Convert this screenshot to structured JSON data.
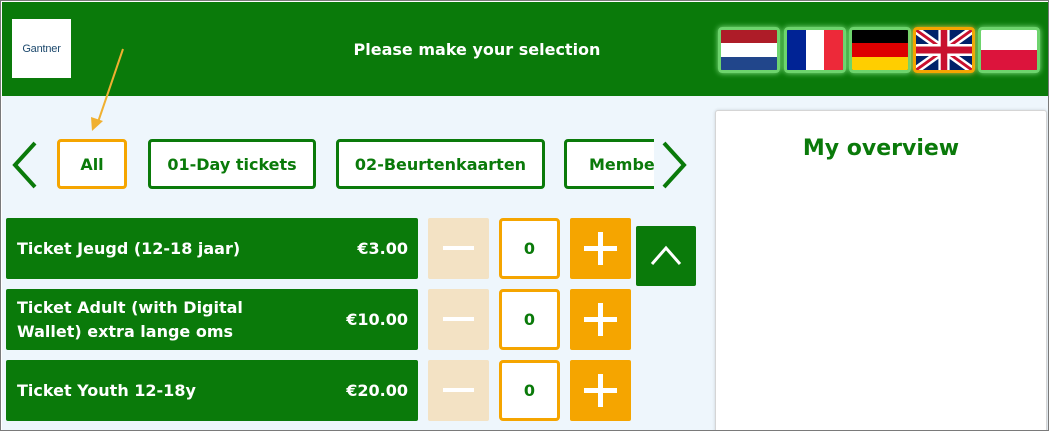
{
  "header": {
    "logo_text": "Gantner",
    "title": "Please make your selection",
    "languages": [
      {
        "code": "nl",
        "label": "Dutch flag",
        "selected": false
      },
      {
        "code": "fr",
        "label": "French flag",
        "selected": false
      },
      {
        "code": "de",
        "label": "German flag",
        "selected": false
      },
      {
        "code": "en",
        "label": "English flag",
        "selected": true
      },
      {
        "code": "pl",
        "label": "Polish flag",
        "selected": false
      }
    ]
  },
  "categories": {
    "tabs": [
      {
        "label": "All",
        "active": true
      },
      {
        "label": "01-Day tickets",
        "active": false
      },
      {
        "label": "02-Beurtenkaarten",
        "active": false
      },
      {
        "label": "Membe",
        "active": false
      }
    ],
    "prev_icon": "chevron-left-icon",
    "next_icon": "chevron-right-icon"
  },
  "products": [
    {
      "name": "Ticket Jeugd (12-18 jaar)",
      "price": "€3.00",
      "quantity": "0"
    },
    {
      "name": "Ticket Adult (with Digital Wallet) extra lange oms",
      "price": "€10.00",
      "quantity": "0"
    },
    {
      "name": "Ticket Youth 12-18y",
      "price": "€20.00",
      "quantity": "0"
    }
  ],
  "overview": {
    "title": "My overview"
  },
  "colors": {
    "brand_green": "#0a7a0a",
    "accent_orange": "#f5a500",
    "minus_disabled": "#f3e2c4",
    "content_bg": "#eef6fc"
  }
}
